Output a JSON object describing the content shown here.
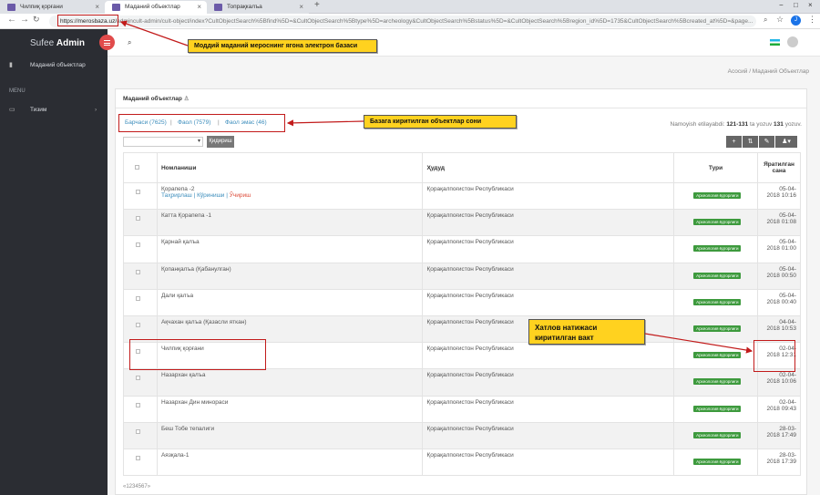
{
  "browser": {
    "tabs": [
      {
        "label": "Чилпиқ қорғани"
      },
      {
        "label": "Маданий объектлар"
      },
      {
        "label": "Топрақкалъа"
      }
    ],
    "url_host": "https://merosbaza.uz/",
    "url_path": "admincult-admin/cult-object/index?CultObjectSearch%5Bfind%5D=&CultObjectSearch%5Btype%5D=archeology&CultObjectSearch%5Bstatus%5D=&CultObjectSearch%5Bregion_id%5D=1735&CultObjectSearch%5Bcreated_at%5D=&page...",
    "avatar_letter": "J"
  },
  "app": {
    "brand_light": "Sufee",
    "brand_bold": "Admin",
    "breadcrumb": "Асосий  /  Маданий Объектлар"
  },
  "sidebar": {
    "items": [
      {
        "label": "Маданий объектлар"
      },
      {
        "label": "Тизим"
      }
    ],
    "section_label": "MENU"
  },
  "panel": {
    "title": "Маданий объектлар",
    "filters": {
      "all": "Барчаси (7625)",
      "active": "Фаол (7579)",
      "inactive": "Фаол эмас (46)",
      "sep": "|"
    },
    "summary_prefix": "Namoyish etilayabdi:",
    "summary_range": "121-131",
    "summary_mid": "ta yozuv",
    "summary_total": "131",
    "summary_suffix": "yozuv.",
    "search_button": "Қидириш",
    "columns": [
      "Номланиши",
      "Ҳудуд",
      "Тури",
      "Яратилган сана"
    ],
    "rows": [
      {
        "name": "Қорапепа -2",
        "region": "Қорақалпоғистон Республикаси",
        "type": "Археология ёдгорлиги",
        "date1": "05-04-",
        "date2": "2018 10:16",
        "actions": {
          "edit": "Таҳрирлаш",
          "view": "Кўриниши",
          "delete": "Ўчириш"
        }
      },
      {
        "name": "Катта Қорапепа -1",
        "region": "Қорақалпоғистон Республикаси",
        "type": "Археология ёдгорлиги",
        "date1": "05-04-",
        "date2": "2018 01:08"
      },
      {
        "name": "Қарнай қалъа",
        "region": "Қорақалпоғистон Республикаси",
        "type": "Археология ёдгорлиги",
        "date1": "05-04-",
        "date2": "2018 01:00"
      },
      {
        "name": "Қопанқалъа (Қабанулган)",
        "region": "Қорақалпоғистон Республикаси",
        "type": "Археология ёдгорлиги",
        "date1": "05-04-",
        "date2": "2018 00:50"
      },
      {
        "name": "Дали қалъа",
        "region": "Қорақалпоғистон Республикаси",
        "type": "Археология ёдгорлиги",
        "date1": "05-04-",
        "date2": "2018 00:40"
      },
      {
        "name": "Ақчахан қалъа (Қазасли яткан)",
        "region": "Қорақалпоғистон Республикаси",
        "type": "Археология ёдгорлиги",
        "date1": "04-04-",
        "date2": "2018 10:53"
      },
      {
        "name": "Чилпиқ қорғани",
        "region": "Қорақалпоғистон Республикаси",
        "type": "Археология ёдгорлиги",
        "date1": "02-04-",
        "date2": "2018 12:31"
      },
      {
        "name": "Назархан қалъа",
        "region": "Қорақалпоғистон Республикаси",
        "type": "Археология ёдгорлиги",
        "date1": "02-04-",
        "date2": "2018 10:06"
      },
      {
        "name": "Назархан Дин минораси",
        "region": "Қорақалпоғистон Республикаси",
        "type": "Археология ёдгорлиги",
        "date1": "02-04-",
        "date2": "2018 09:43"
      },
      {
        "name": "Беш Тобе тепалиги",
        "region": "Қорақалпоғистон Республикаси",
        "type": "Археология ёдгорлиги",
        "date1": "28-03-",
        "date2": "2018 17:49"
      },
      {
        "name": "Аязқала-1",
        "region": "Қорақалпоғистон Республикаси",
        "type": "Археология ёдгорлиги",
        "date1": "28-03-",
        "date2": "2018 17:39"
      }
    ],
    "pager": "«1234567»"
  },
  "annotations": {
    "top_callout": "Моддий маданий мероснинг ягона электрон базаси",
    "count_callout": "Базага киритилган объектлар сони",
    "time_callout": "Хатлов натижаси киритилган вакт"
  },
  "colors": {
    "sidebar": "#2b2d33",
    "accent_red": "#e14b4b",
    "link_blue": "#3c8dbc",
    "badge_green": "#3d9a3d",
    "callout_yellow": "#ffd21f",
    "annotation_red": "#c21b1b"
  }
}
